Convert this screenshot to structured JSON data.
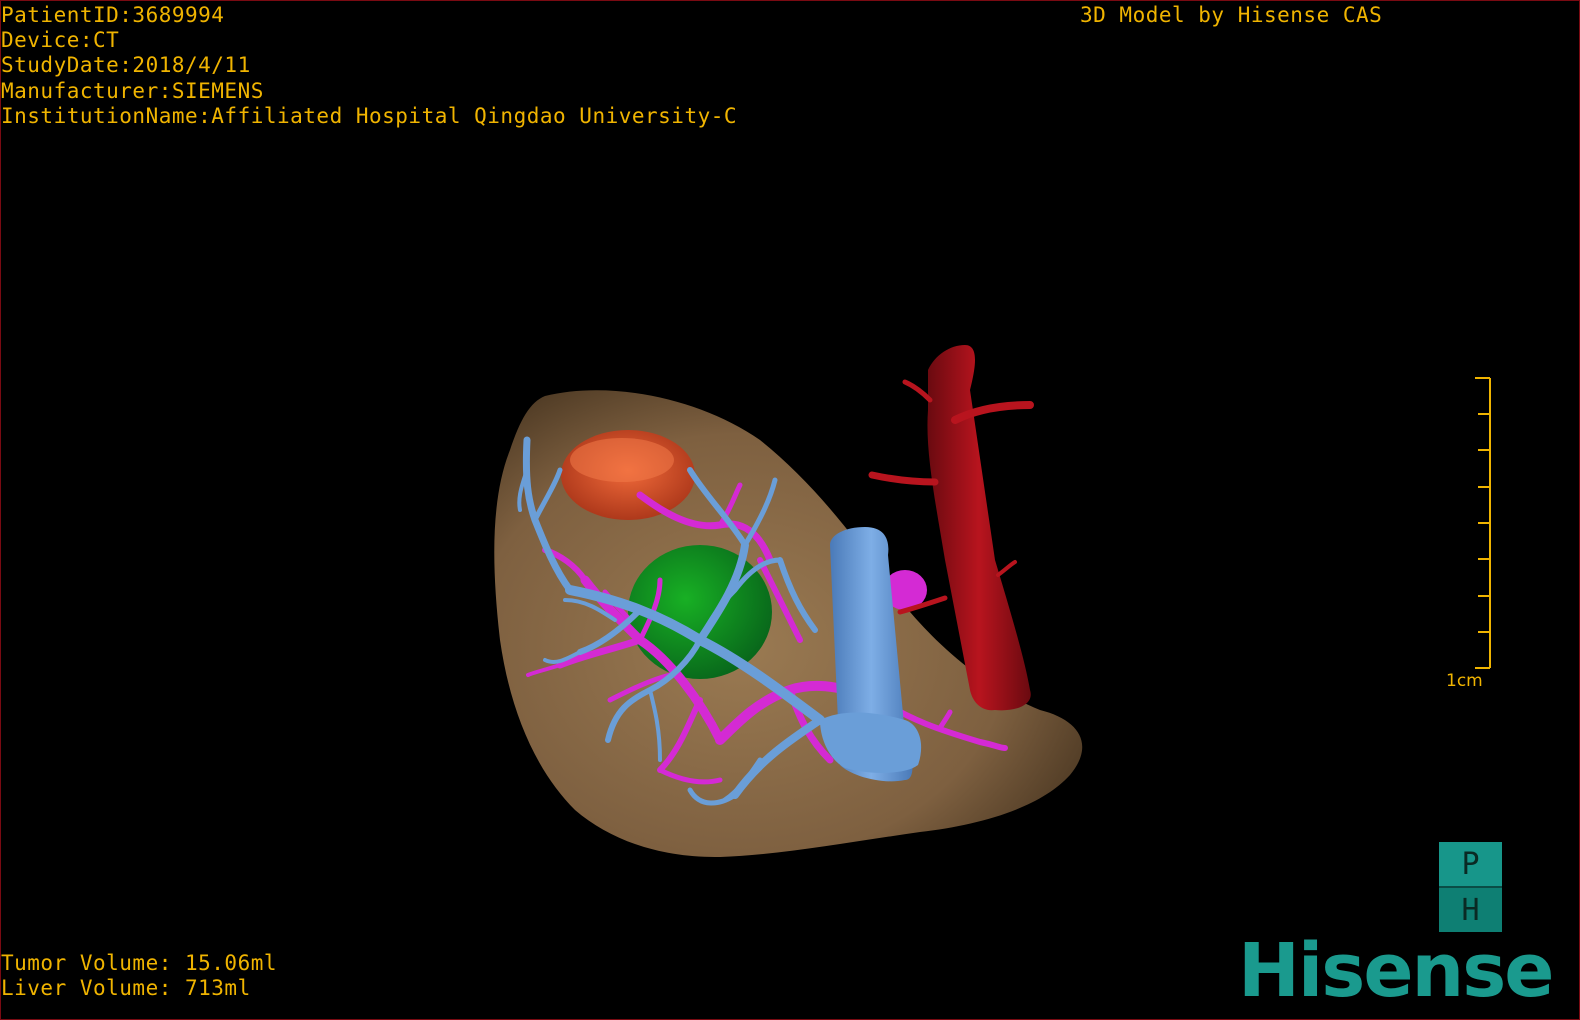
{
  "header": {
    "patient_id": "PatientID:3689994",
    "device": "Device:CT",
    "study_date": "StudyDate:2018/4/11",
    "manufacturer": "Manufacturer:SIEMENS",
    "institution": "InstitutionName:Affiliated Hospital Qingdao University-C"
  },
  "title": "3D Model by Hisense CAS",
  "volumes": {
    "tumor": "Tumor Volume: 15.06ml",
    "liver": "Liver Volume: 713ml"
  },
  "scale": {
    "label": "1cm"
  },
  "orientation": {
    "top": "P",
    "bottom": "H"
  },
  "logo": {
    "text": "Hisense"
  },
  "colors": {
    "overlay_text": "#f0b400",
    "liver": "#8a6a44",
    "tumor": "#0e8c18",
    "portal_vein": "#6a9ed8",
    "hepatic_vein": "#d42ad4",
    "artery": "#a0121c",
    "gallbladder": "#e0502a",
    "brand": "#1a9a8e"
  },
  "model_parts": [
    "liver",
    "tumor",
    "portal-vein",
    "hepatic-vein",
    "artery",
    "gallbladder"
  ]
}
